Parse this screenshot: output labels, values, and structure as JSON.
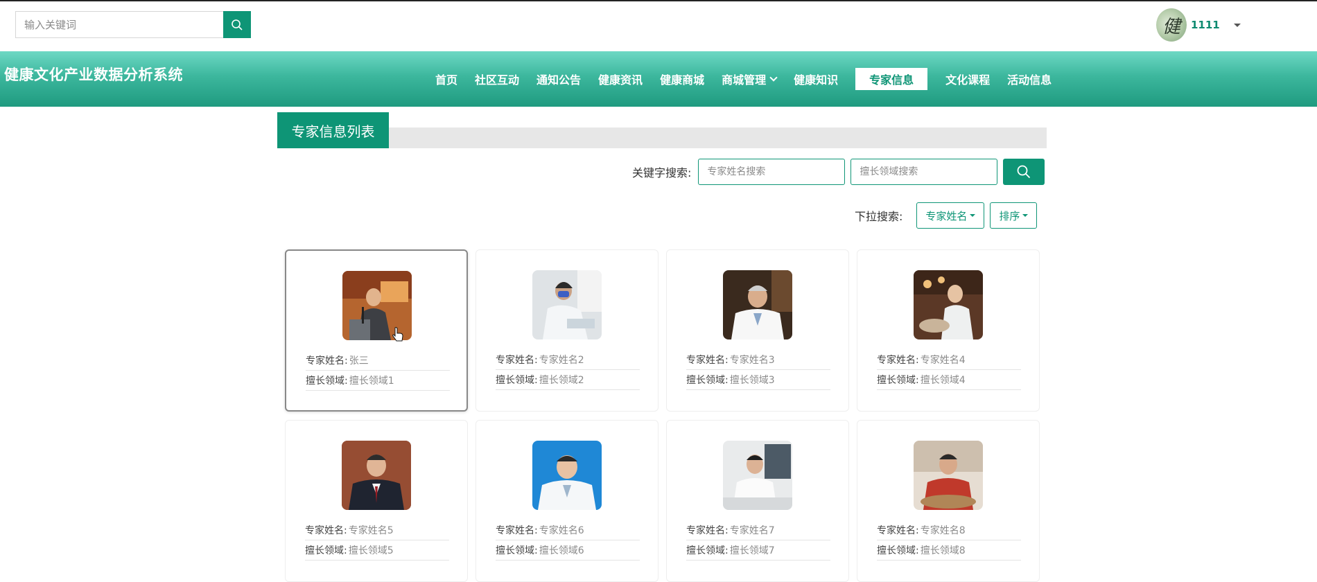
{
  "header": {
    "search_placeholder": "输入关键词",
    "user_name": "1111",
    "avatar_text": "健"
  },
  "brand": "健康文化产业数据分析系统",
  "nav": {
    "items": [
      "首页",
      "社区互动",
      "通知公告",
      "健康资讯",
      "健康商城",
      "商城管理",
      "健康知识",
      "专家信息",
      "文化课程",
      "活动信息"
    ],
    "active": "专家信息"
  },
  "section_title": "专家信息列表",
  "filters": {
    "keyword_label": "关键字搜索:",
    "name_placeholder": "专家姓名搜索",
    "field_placeholder": "擅长领域搜索",
    "dropdown_label": "下拉搜索:",
    "dropdown_name": "专家姓名",
    "dropdown_sort": "排序"
  },
  "card_labels": {
    "name": "专家姓名:",
    "field": "擅长领域:"
  },
  "experts": [
    {
      "name": "张三",
      "field": "擅长领域1"
    },
    {
      "name": "专家姓名2",
      "field": "擅长领域2"
    },
    {
      "name": "专家姓名3",
      "field": "擅长领域3"
    },
    {
      "name": "专家姓名4",
      "field": "擅长领域4"
    },
    {
      "name": "专家姓名5",
      "field": "擅长领域5"
    },
    {
      "name": "专家姓名6",
      "field": "擅长领域6"
    },
    {
      "name": "专家姓名7",
      "field": "擅长领域7"
    },
    {
      "name": "专家姓名8",
      "field": "擅长领域8"
    }
  ],
  "colors": {
    "accent": "#0e9576",
    "nav_light": "#6dd8c4",
    "nav_dark": "#1f9a7f"
  }
}
